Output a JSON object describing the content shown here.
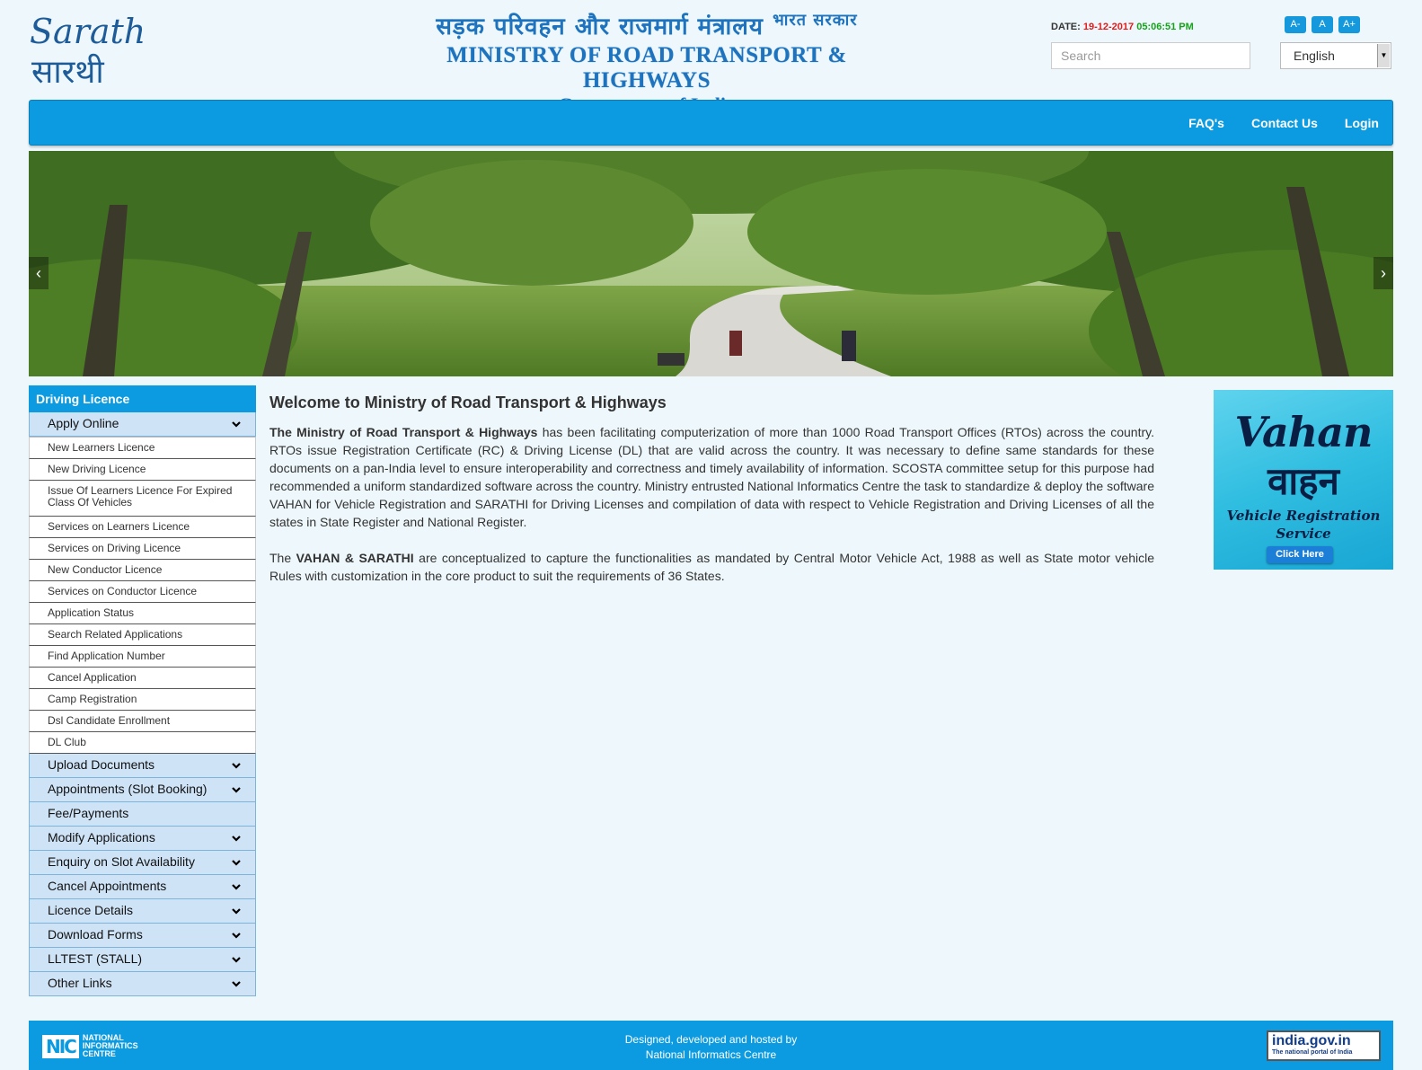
{
  "header": {
    "logo_en": "Sarathi",
    "logo_hi": "सारथी",
    "hindi_title": "सड़क परिवहन और राजमार्ग मंत्रालय",
    "hindi_sub": "भारत सरकार",
    "ministry_title": "MINISTRY OF ROAD TRANSPORT & HIGHWAYS",
    "ministry_sub": "Government of India",
    "date_label": "DATE:",
    "date": "19-12-2017",
    "time": "05:06:51 PM",
    "font_small": "A-",
    "font_normal": "A",
    "font_large": "A+",
    "search_placeholder": "Search",
    "language": "English"
  },
  "nav": {
    "faq": "FAQ's",
    "contact": "Contact Us",
    "login": "Login"
  },
  "carousel": {
    "prev": "‹",
    "next": "›"
  },
  "sidebar": {
    "title": "Driving Licence",
    "apply_online": "Apply Online",
    "sub_items": [
      "New Learners Licence",
      "New Driving Licence",
      "Issue Of Learners Licence For Expired Class Of Vehicles",
      "Services on Learners Licence",
      "Services on Driving Licence",
      "New Conductor Licence",
      "Services on Conductor Licence",
      "Application Status",
      "Search Related Applications",
      "Find Application Number",
      "Cancel Application",
      "Camp Registration",
      "Dsl Candidate Enrollment",
      "DL Club"
    ],
    "sections": [
      "Upload Documents",
      "Appointments (Slot Booking)",
      "Fee/Payments",
      "Modify Applications",
      "Enquiry on Slot Availability",
      "Cancel Appointments",
      "Licence Details",
      "Download Forms",
      "LLTEST (STALL)",
      "Other Links"
    ]
  },
  "content": {
    "heading": "Welcome to Ministry of Road Transport & Highways",
    "p1_bold": "The Ministry of Road Transport & Highways",
    "p1_rest": " has been facilitating computerization of more than 1000 Road Transport Offices (RTOs) across the country. RTOs issue Registration Certificate (RC) & Driving License (DL) that are valid across the country. It was necessary to define same standards for these documents on a pan-India level to ensure interoperability and correctness and timely availability of information. SCOSTA committee setup for this purpose had recommended a uniform standardized software across the country. Ministry entrusted National Informatics Centre the task to standardize & deploy the software VAHAN for Vehicle Registration and SARATHI for Driving Licenses and compilation of data with respect to Vehicle Registration and Driving Licenses of all the states in State Register and National Register.",
    "p2_pre": "The ",
    "p2_bold": "VAHAN & SARATHI",
    "p2_rest": " are conceptualized to capture the functionalities as mandated by Central Motor Vehicle Act, 1988 as well as State motor vehicle Rules with customization in the core product to suit the requirements of 36 States."
  },
  "vahan_ad": {
    "title_en": "Vahan",
    "title_hi": "वाहन",
    "line1": "Vehicle Registration",
    "line2": "Service",
    "button": "Click Here"
  },
  "footer": {
    "nic_mark": "NIC",
    "nic_line1": "NATIONAL",
    "nic_line2": "INFORMATICS",
    "nic_line3": "CENTRE",
    "credit_line1": "Designed, developed and hosted by",
    "credit_line2": "National Informatics Centre",
    "indiagov": "india.gov.in",
    "indiagov_sub": "The national portal of India"
  }
}
